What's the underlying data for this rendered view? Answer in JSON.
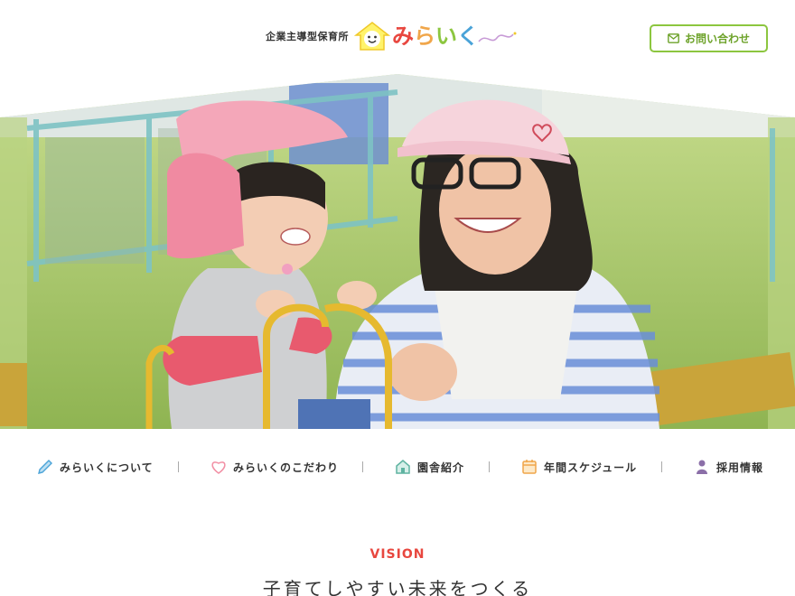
{
  "header": {
    "logo_subtitle": "企業主導型保育所",
    "logo_name": [
      "み",
      "ら",
      "い",
      "く"
    ],
    "logo_name_colors": [
      "#e8473f",
      "#f0a64a",
      "#8cc63f",
      "#4aa3d8"
    ],
    "contact_label": "お問い合わせ",
    "contact_icon": "mail-icon"
  },
  "hero": {
    "alt": "",
    "colors": {
      "grass": "#a9c96a",
      "fence": "#7ec3c4",
      "pink_hat": "#f4a7b9",
      "stripe_blue": "#6a8fd8"
    }
  },
  "nav": {
    "items": [
      {
        "label": "みらいくについて",
        "icon": "pencil-icon",
        "color": "#4aa3d8"
      },
      {
        "label": "みらいくのこだわり",
        "icon": "heart-icon",
        "color": "#f28fa4"
      },
      {
        "label": "園舎紹介",
        "icon": "house-icon",
        "color": "#5fb3a1"
      },
      {
        "label": "年間スケジュール",
        "icon": "calendar-icon",
        "color": "#f0a64a"
      },
      {
        "label": "採用情報",
        "icon": "person-icon",
        "color": "#8b6fa8"
      }
    ]
  },
  "vision": {
    "label": "VISION",
    "title": "子育てしやすい未来をつくる"
  }
}
